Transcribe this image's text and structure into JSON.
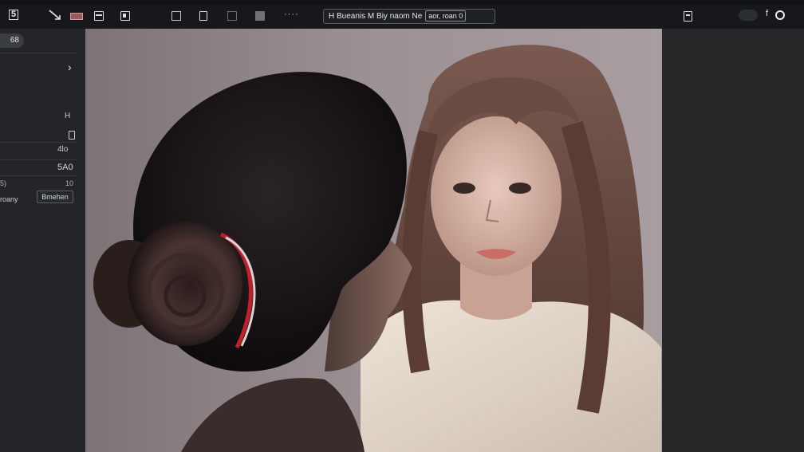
{
  "toolbar": {
    "app_label": "5",
    "more_label": "····",
    "title_text": "H Bueanis M Biy naom Ne",
    "title_badge": "aor, roan 0",
    "right_icon_label": "f"
  },
  "sidebar": {
    "pill_label": "68",
    "expand_glyph": "›",
    "row1_value": "H",
    "row3_value": "4lo",
    "row4_value": "5A0",
    "row5_left": "5)",
    "row5_right": "10",
    "row6_label": "roany",
    "row6_button": "Bmehen"
  },
  "colors": {
    "accent_red": "#c0202a",
    "canvas_bg": "#8a7f82"
  },
  "icons": [
    "app-icon",
    "arrow-tool-icon",
    "swatch-icon",
    "layer-icon",
    "frame-icon",
    "doc-icon",
    "info-icon",
    "grid-icon",
    "image-icon",
    "more-icon",
    "export-icon",
    "toggle-icon",
    "record-icon",
    "chevron-right-icon",
    "phone-icon"
  ]
}
